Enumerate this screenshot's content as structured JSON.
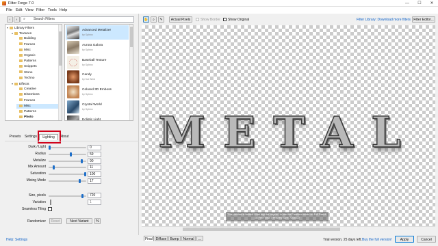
{
  "window": {
    "title": "Filter Forge 7.0",
    "min": "—",
    "max": "☐",
    "close": "✕"
  },
  "menu": [
    "File",
    "Edit",
    "View",
    "Filter",
    "Tools",
    "Help"
  ],
  "search": {
    "placeholder": "Search Filters"
  },
  "tree": [
    {
      "label": "Library Filters",
      "level": 0,
      "exp": "▾"
    },
    {
      "label": "Textures",
      "level": 1,
      "exp": "▾"
    },
    {
      "label": "Building",
      "level": 2
    },
    {
      "label": "Frames",
      "level": 2
    },
    {
      "label": "Misc",
      "level": 2
    },
    {
      "label": "Organic",
      "level": 2
    },
    {
      "label": "Patterns",
      "level": 2
    },
    {
      "label": "Snippets",
      "level": 2
    },
    {
      "label": "Stone",
      "level": 2
    },
    {
      "label": "Techno",
      "level": 2
    },
    {
      "label": "Effects",
      "level": 1,
      "exp": "▾"
    },
    {
      "label": "Creative",
      "level": 2
    },
    {
      "label": "Distortions",
      "level": 2
    },
    {
      "label": "Frames",
      "level": 2
    },
    {
      "label": "Misc",
      "level": 2,
      "selected": true
    },
    {
      "label": "Patterns",
      "level": 2
    },
    {
      "label": "Photo",
      "level": 2
    }
  ],
  "filters": [
    {
      "name": "Advanced Metalizer",
      "author": "by Sphinx",
      "selected": true
    },
    {
      "name": "Aurora Galora",
      "author": "by Sphinx"
    },
    {
      "name": "Baseball Texture",
      "author": "by Sphinx"
    },
    {
      "name": "Candy",
      "author": "by Kai Wind"
    },
    {
      "name": "Colored 3D Emboss",
      "author": "by Sphinx"
    },
    {
      "name": "Crystal World",
      "author": "by Sphinx"
    },
    {
      "name": "Ecliptic Light",
      "author": "by Sphinx"
    }
  ],
  "tabs": [
    "Presets",
    "Settings",
    "Lighting",
    "About"
  ],
  "settings": [
    {
      "label": "Dark / Light",
      "value": "0",
      "level": 0.0
    },
    {
      "label": "Radius",
      "value": "59",
      "level": 0.59
    },
    {
      "label": "Metalize",
      "value": "90",
      "level": 0.9
    },
    {
      "label": "Mix Amount",
      "value": "11",
      "level": 0.11
    },
    {
      "label": "Saturation",
      "value": "100",
      "level": 1.0
    },
    {
      "label": "Mixing Mode",
      "value": "17",
      "level": 0.85
    }
  ],
  "size": {
    "label": "Size, pixels",
    "value": "720",
    "level": 0.93
  },
  "variation": {
    "label": "Variation",
    "value": "1"
  },
  "seamless": {
    "label": "Seamless Tiling"
  },
  "randomizer": {
    "label": "Randomizer",
    "reset": "Reset",
    "next": "Next Variant",
    "percent": "%"
  },
  "toolbar": {
    "actual_pixels": "Actual Pixels",
    "show_border": "Show Border",
    "show_original": "Show Original",
    "library_link": "Filter Library: Download more filters",
    "filter_editor": "Filter Editor..."
  },
  "canvas_text": "METAL",
  "trial_notice": "This preview is limited! Must buy the original, to use the Freeform mode on Full Result, on Free View > Preview Size: 720x400",
  "bottom_tabs": [
    "Final",
    "Diffuse",
    "Bump",
    "Normal",
    "..."
  ],
  "status": {
    "help": "Help: Settings",
    "trial": "Trial version, 25 days left.",
    "buy": "Buy the full version!",
    "apply": "Apply",
    "cancel": "Cancel"
  }
}
